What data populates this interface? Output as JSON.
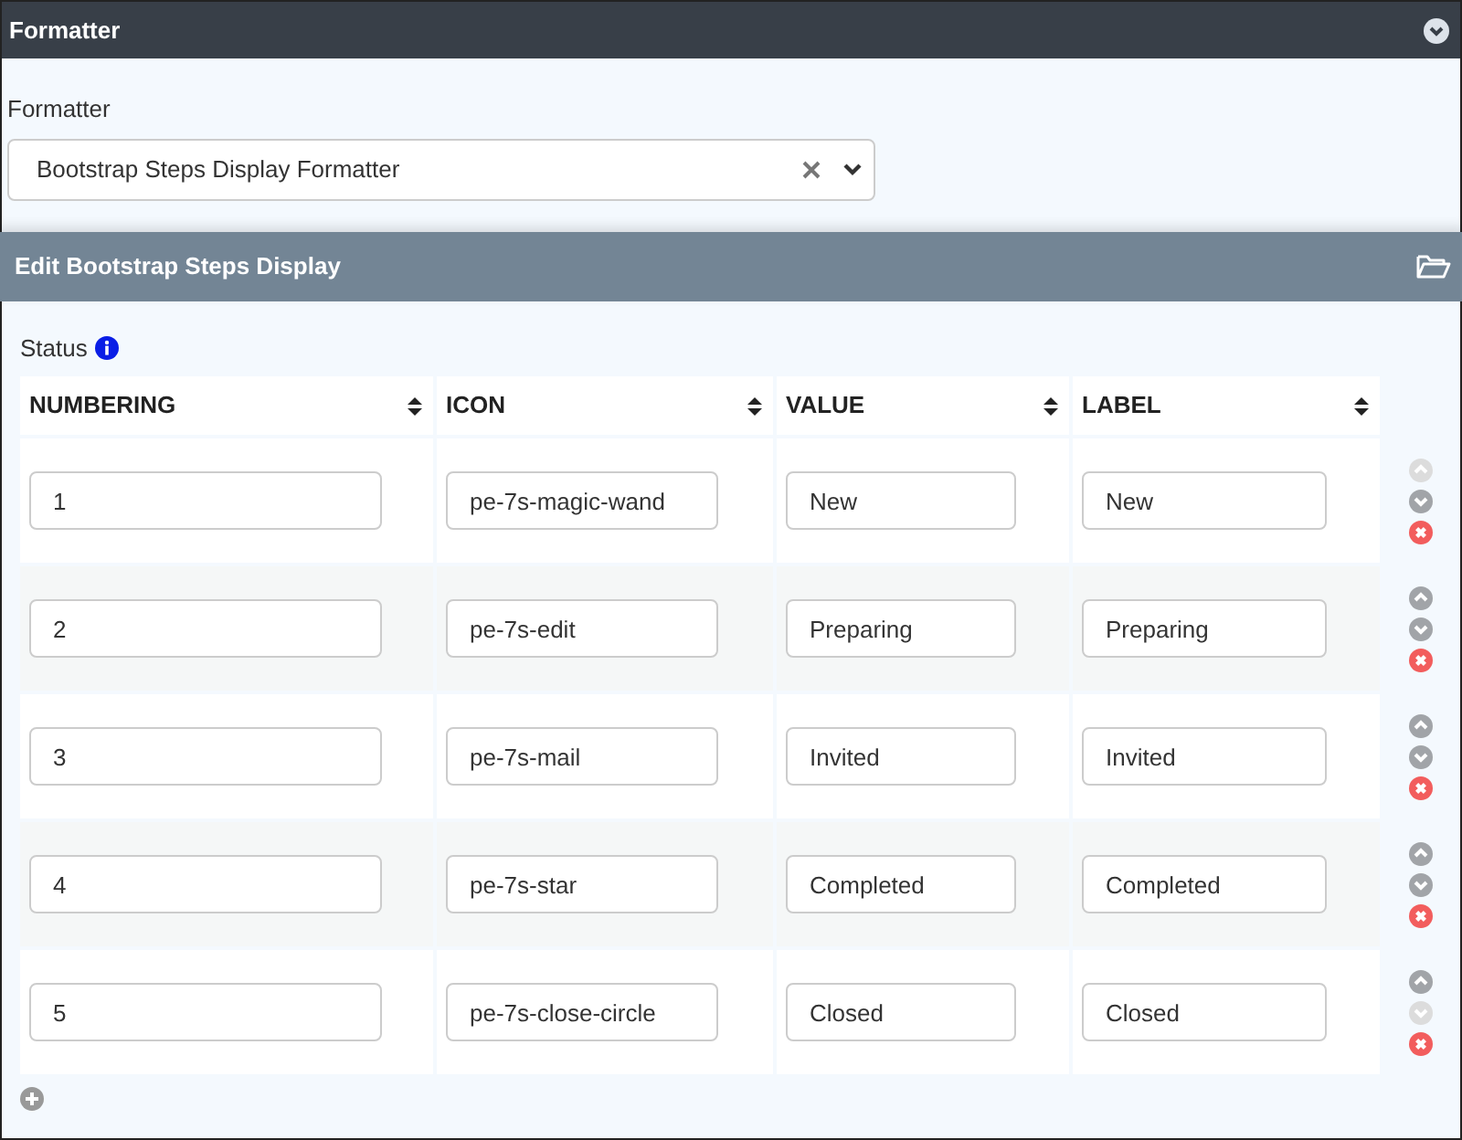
{
  "panel": {
    "title": "Formatter",
    "collapsed": false
  },
  "formatter": {
    "label": "Formatter",
    "value": "Bootstrap Steps Display Formatter"
  },
  "section": {
    "title": "Edit Bootstrap Steps Display"
  },
  "status": {
    "label": "Status"
  },
  "table": {
    "columns": [
      "NUMBERING",
      "ICON",
      "VALUE",
      "LABEL"
    ],
    "rows": [
      {
        "numbering": "1",
        "icon": "pe-7s-magic-wand",
        "value": "New",
        "label": "New",
        "up_disabled": true,
        "down_disabled": false
      },
      {
        "numbering": "2",
        "icon": "pe-7s-edit",
        "value": "Preparing",
        "label": "Preparing",
        "up_disabled": false,
        "down_disabled": false
      },
      {
        "numbering": "3",
        "icon": "pe-7s-mail",
        "value": "Invited",
        "label": "Invited",
        "up_disabled": false,
        "down_disabled": false
      },
      {
        "numbering": "4",
        "icon": "pe-7s-star",
        "value": "Completed",
        "label": "Completed",
        "up_disabled": false,
        "down_disabled": false
      },
      {
        "numbering": "5",
        "icon": "pe-7s-close-circle",
        "value": "Closed",
        "label": "Closed",
        "up_disabled": false,
        "down_disabled": true
      }
    ]
  }
}
